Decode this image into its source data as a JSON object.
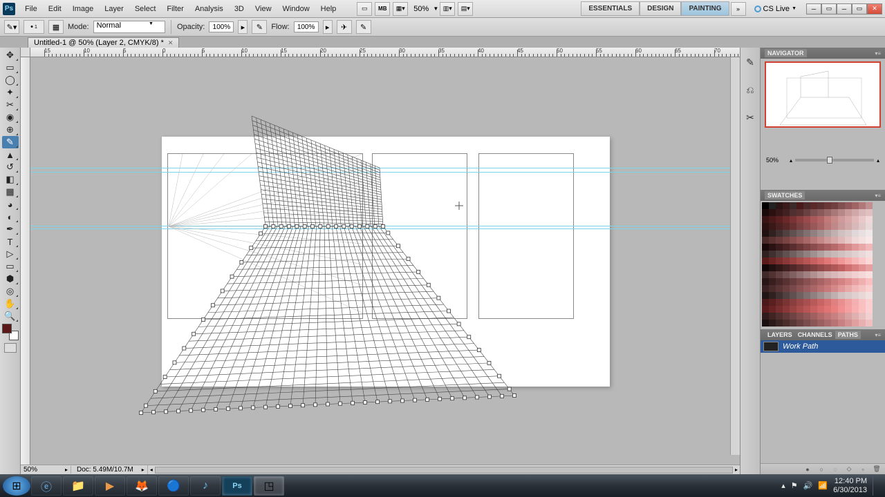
{
  "menubar": {
    "items": [
      "File",
      "Edit",
      "Image",
      "Layer",
      "Select",
      "Filter",
      "Analysis",
      "3D",
      "View",
      "Window",
      "Help"
    ],
    "zoom": "50%",
    "workspaces": [
      "ESSENTIALS",
      "DESIGN",
      "PAINTING"
    ],
    "active_workspace": 2,
    "cslive": "CS Live"
  },
  "options": {
    "brush_size": "1",
    "mode_label": "Mode:",
    "mode_value": "Normal",
    "opacity_label": "Opacity:",
    "opacity_value": "100%",
    "flow_label": "Flow:",
    "flow_value": "100%"
  },
  "document": {
    "tab": "Untitled-1 @ 50% (Layer 2, CMYK/8) *",
    "status_zoom": "50%",
    "status_doc": "Doc: 5.49M/10.7M"
  },
  "ruler_labels": [
    "15",
    "10",
    "5",
    "0",
    "5",
    "10",
    "15",
    "20",
    "25",
    "30",
    "35",
    "40",
    "45",
    "50",
    "55",
    "60",
    "65",
    "70"
  ],
  "panels": {
    "navigator": {
      "title": "NAVIGATOR",
      "zoom": "50%"
    },
    "swatches": {
      "title": "SWATCHES"
    },
    "layers_tabs": [
      "LAYERS",
      "CHANNELS",
      "PATHS"
    ],
    "active_tab": 2,
    "path_name": "Work Path"
  },
  "taskbar": {
    "time": "12:40 PM",
    "date": "6/30/2013"
  },
  "swatch_colors": [
    "#000000",
    "#222222",
    "#2a1414",
    "#3a1a1a",
    "#3a2a2a",
    "#4a1a1a",
    "#4a2a2a",
    "#5a2a2a",
    "#5a3030",
    "#6a3636",
    "#704040",
    "#805050",
    "#905858",
    "#a06464",
    "#b07878",
    "#c09090",
    "#1a0a0a",
    "#2a1010",
    "#381818",
    "#402020",
    "#503030",
    "#5a3232",
    "#6a4040",
    "#7a5050",
    "#8a5a5a",
    "#986868",
    "#a87878",
    "#b88888",
    "#c89a9a",
    "#d0a8a8",
    "#d8b8b8",
    "#e0c0c0",
    "#3a1414",
    "#4a1a1a",
    "#5a2020",
    "#6a2828",
    "#7a3232",
    "#8a4040",
    "#9a4a4a",
    "#a85858",
    "#b06464",
    "#c07878",
    "#c88888",
    "#d09a9a",
    "#d8a8a8",
    "#e0b8b8",
    "#e8c8c8",
    "#f0d8d8",
    "#2a1010",
    "#3a1818",
    "#4a2020",
    "#582828",
    "#683232",
    "#784040",
    "#884a4a",
    "#985858",
    "#a86464",
    "#b87878",
    "#c08888",
    "#c89a9a",
    "#d0a8a8",
    "#d8b8b8",
    "#e0c8c8",
    "#e8d8d8",
    "#201010",
    "#302020",
    "#403030",
    "#504040",
    "#605050",
    "#706060",
    "#807070",
    "#908080",
    "#a09090",
    "#b0a0a0",
    "#c0b0b0",
    "#d0c0c0",
    "#d8c8c8",
    "#e0d8d8",
    "#e8e0e0",
    "#f0e8e8",
    "#4a2828",
    "#5a3232",
    "#6a3a3a",
    "#7a4444",
    "#8a5050",
    "#9a5a5a",
    "#a86868",
    "#b87878",
    "#c48888",
    "#d09a9a",
    "#d8a8a8",
    "#e0b8b8",
    "#e8c8c8",
    "#f0d8d8",
    "#f4e0e0",
    "#f8e8e8",
    "#1a0808",
    "#2a1212",
    "#3a1a1a",
    "#4a2424",
    "#5a2e2e",
    "#6a3838",
    "#7a4242",
    "#8a4c4c",
    "#9a5656",
    "#a86060",
    "#b86a6a",
    "#c87878",
    "#d48888",
    "#e09898",
    "#e8a8a8",
    "#f0b8b8",
    "#302020",
    "#403030",
    "#504040",
    "#605050",
    "#706060",
    "#807070",
    "#908080",
    "#a09090",
    "#b0a0a0",
    "#c0b0b0",
    "#c8b8b8",
    "#d0c0c0",
    "#d8c8c8",
    "#e0d0d0",
    "#e8d8d8",
    "#f0e0e0",
    "#5a1a1a",
    "#6a2424",
    "#7a2e2e",
    "#8a3838",
    "#9a4242",
    "#a84c4c",
    "#b85656",
    "#c86060",
    "#d46a6a",
    "#e07878",
    "#e88888",
    "#f09898",
    "#f4a8a8",
    "#f8b8b8",
    "#fac8c8",
    "#fcd8d8",
    "#100808",
    "#201010",
    "#301818",
    "#402020",
    "#502828",
    "#603030",
    "#703838",
    "#804040",
    "#904848",
    "#a05050",
    "#b05858",
    "#c06060",
    "#d07070",
    "#d88080",
    "#e09090",
    "#e8a0a0",
    "#402828",
    "#503232",
    "#604040",
    "#705050",
    "#806060",
    "#907070",
    "#a08080",
    "#b09090",
    "#c0a0a0",
    "#d0b0b0",
    "#d8b8b8",
    "#e0c0c0",
    "#e8c8c8",
    "#f0d0d0",
    "#f4d8d8",
    "#f8e0e0",
    "#281414",
    "#381e1e",
    "#482828",
    "#583232",
    "#683c3c",
    "#784646",
    "#885050",
    "#985a5a",
    "#a86464",
    "#b86e6e",
    "#c87878",
    "#d48282",
    "#e09090",
    "#e8a0a0",
    "#f0b0b0",
    "#f8c0c0",
    "#3a2020",
    "#4a2a2a",
    "#5a3434",
    "#6a3e3e",
    "#7a4848",
    "#8a5252",
    "#9a5c5c",
    "#aa6666",
    "#ba7070",
    "#c87a7a",
    "#d48888",
    "#e09898",
    "#e8a8a8",
    "#f0b8b8",
    "#f4c4c4",
    "#f8d0d0",
    "#201414",
    "#302020",
    "#403030",
    "#504040",
    "#605050",
    "#706060",
    "#807070",
    "#908080",
    "#a09090",
    "#b0a0a0",
    "#c0b0b0",
    "#d0c0c0",
    "#d8c8c8",
    "#e0d0d0",
    "#e8d8d8",
    "#f0e0e0",
    "#4a1818",
    "#5a2020",
    "#6a2a2a",
    "#7a3434",
    "#8a3e3e",
    "#9a4848",
    "#a85050",
    "#b85a5a",
    "#c86464",
    "#d47070",
    "#e08080",
    "#e89090",
    "#f0a0a0",
    "#f4b0b0",
    "#f8c0c0",
    "#fad0d0",
    "#581a1a",
    "#682424",
    "#782e2e",
    "#883838",
    "#984242",
    "#a84c4c",
    "#b85656",
    "#c86060",
    "#d46a6a",
    "#e07474",
    "#e88080",
    "#f09090",
    "#f4a0a0",
    "#f8b0b0",
    "#fac0c0",
    "#fcd0d0",
    "#301a1a",
    "#402424",
    "#502e2e",
    "#603838",
    "#704242",
    "#804c4c",
    "#905656",
    "#a06060",
    "#b06a6a",
    "#c07474",
    "#c88080",
    "#d09090",
    "#d8a0a0",
    "#e0b0b0",
    "#e8c0c0",
    "#f0d0d0",
    "#1a1010",
    "#2a1a1a",
    "#3a2424",
    "#4a2e2e",
    "#5a3838",
    "#6a4242",
    "#7a4c4c",
    "#8a5656",
    "#9a6060",
    "#a86a6a",
    "#b87474",
    "#c88080",
    "#d49090",
    "#e0a0a0",
    "#e8b0b0",
    "#f0c0c0"
  ]
}
